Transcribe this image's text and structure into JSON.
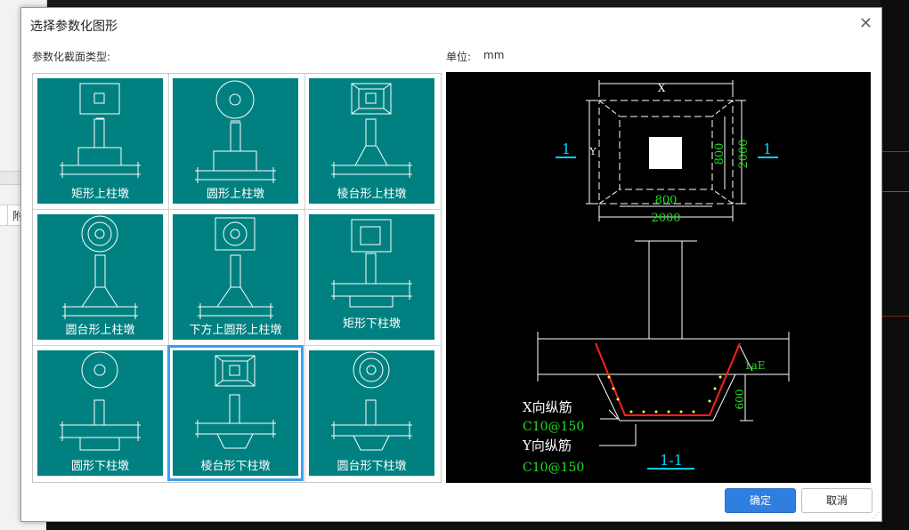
{
  "dialog": {
    "title": "选择参数化图形",
    "close_glyph": "✕",
    "section_label": "参数化截面类型:",
    "unit_label": "单位:",
    "unit_value": "mm"
  },
  "shapes": [
    {
      "label": "矩形上柱墩"
    },
    {
      "label": "圆形上柱墩"
    },
    {
      "label": "棱台形上柱墩"
    },
    {
      "label": "圆台形上柱墩"
    },
    {
      "label": "下方上圆形上柱墩"
    },
    {
      "label": "矩形下柱墩"
    },
    {
      "label": "圆形下柱墩"
    },
    {
      "label": "棱台形下柱墩",
      "selected": true
    },
    {
      "label": "圆台形下柱墩"
    }
  ],
  "preview": {
    "dim_x": "X",
    "dim_y": "Y",
    "dim_800_bottom": "800",
    "dim_800_side": "800",
    "dim_2000_bottom": "2000",
    "dim_2000_side": "2000",
    "section_mark_left": "1",
    "section_mark_right": "1",
    "dim_1ae": "1aE",
    "dim_600": "600",
    "x_rebar_label": "X向纵筋",
    "x_rebar_value": "C10@150",
    "y_rebar_label": "Y向纵筋",
    "y_rebar_value": "C10@150",
    "section_title": "1-1"
  },
  "buttons": {
    "ok": "确定",
    "cancel": "取消"
  },
  "background": {
    "left_cell_text": "附"
  },
  "colors": {
    "tile_bg": "#008080",
    "selection": "#3aa0f0",
    "ok_bg": "#2f7fe0",
    "preview_bg": "#000000",
    "cad_cyan": "#00d0ff",
    "cad_green": "#20e020",
    "cad_red": "#ff2020",
    "cad_yellow": "#ffff40"
  }
}
